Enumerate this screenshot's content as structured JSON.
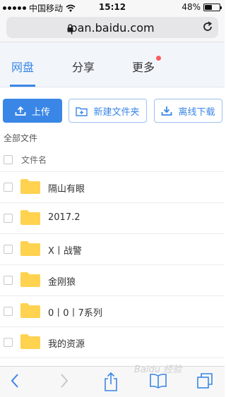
{
  "status_bar": {
    "carrier": "中国移动",
    "time": "15:12",
    "battery": "48%"
  },
  "browser": {
    "url": "pan.baidu.com"
  },
  "tabs": [
    {
      "label": "网盘",
      "active": true
    },
    {
      "label": "分享",
      "active": false
    },
    {
      "label": "更多",
      "active": false,
      "badge_dot": true
    }
  ],
  "toolbar": {
    "upload_label": "上传",
    "new_folder_label": "新建文件夹",
    "offline_download_label": "离线下载"
  },
  "section_title": "全部文件",
  "list": {
    "header_label": "文件名",
    "items": [
      {
        "name": "隔山有眼"
      },
      {
        "name": "2017.2"
      },
      {
        "name": "X丨战警"
      },
      {
        "name": "金刚狼"
      },
      {
        "name": "0丨0丨7系列"
      },
      {
        "name": "我的资源"
      }
    ]
  },
  "watermark": "Baidu 经验",
  "colors": {
    "accent": "#3a86e6",
    "folder": "#ffd250",
    "badge": "#ff5b5b"
  }
}
